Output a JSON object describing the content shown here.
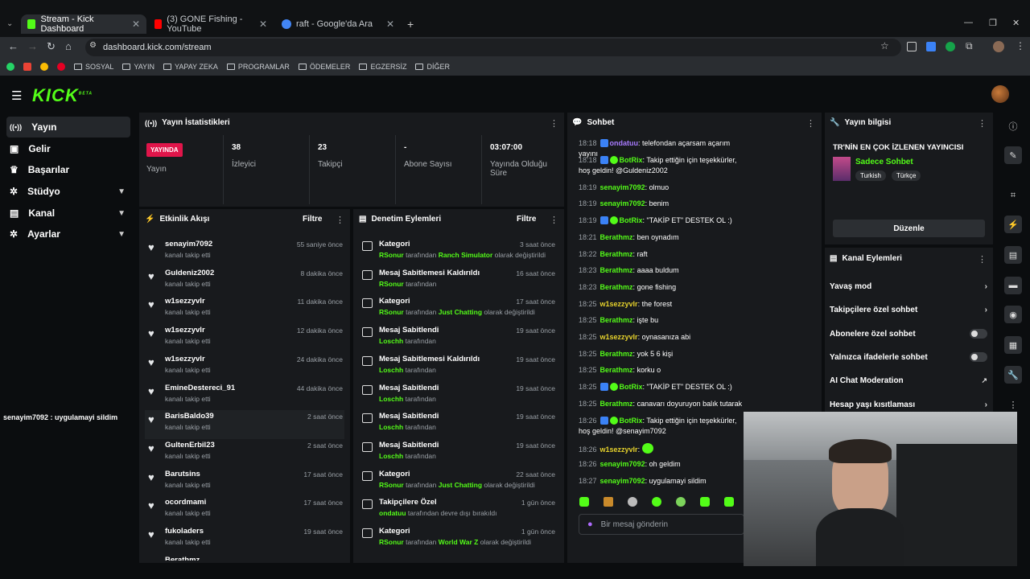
{
  "browser": {
    "tabs": [
      {
        "title": "Stream - Kick Dashboard",
        "icon": "kick-favicon"
      },
      {
        "title": "(3) GONE Fishing - YouTube",
        "icon": "youtube-favicon"
      },
      {
        "title": "raft - Google'da Ara",
        "icon": "google-favicon"
      }
    ],
    "url": "dashboard.kick.com/stream",
    "bookmarks": [
      "SOSYAL",
      "YAYIN",
      "YAPAY ZEKA",
      "PROGRAMLAR",
      "ÖDEMELER",
      "EGZERSİZ",
      "DİĞER"
    ]
  },
  "brand": {
    "logo": "KICK",
    "beta": "BETA",
    "accent": "#53fc18"
  },
  "sidebar": {
    "items": [
      {
        "label": "Yayın",
        "icon": "broadcast-icon"
      },
      {
        "label": "Gelir",
        "icon": "revenue-icon"
      },
      {
        "label": "Başarılar",
        "icon": "trophy-icon"
      },
      {
        "label": "Stüdyo",
        "icon": "gear-icon"
      },
      {
        "label": "Kanal",
        "icon": "channel-icon"
      },
      {
        "label": "Ayarlar",
        "icon": "gear-icon"
      }
    ]
  },
  "overlay_chat": "senayim7092 : uygulamayi sildim",
  "stats": {
    "title": "Yayın İstatistikleri",
    "live_badge": "YAYINDA",
    "live_label": "Yayın",
    "items": [
      {
        "value": "38",
        "label": "İzleyici"
      },
      {
        "value": "23",
        "label": "Takipçi"
      },
      {
        "value": "-",
        "label": "Abone Sayısı"
      },
      {
        "value": "03:07:00",
        "label": "Yayında Olduğu Süre"
      }
    ]
  },
  "activity": {
    "title": "Etkinlik Akışı",
    "filter": "Filtre",
    "items": [
      {
        "name": "senayim7092",
        "sub": "kanalı takip etti",
        "time": "55 saniye önce"
      },
      {
        "name": "Guldeniz2002",
        "sub": "kanalı takip etti",
        "time": "8 dakika önce"
      },
      {
        "name": "w1sezzyvlr",
        "sub": "kanalı takip etti",
        "time": "11 dakika önce"
      },
      {
        "name": "w1sezzyvlr",
        "sub": "kanalı takip etti",
        "time": "12 dakika önce"
      },
      {
        "name": "w1sezzyvlr",
        "sub": "kanalı takip etti",
        "time": "24 dakika önce"
      },
      {
        "name": "EmineDestereci_91",
        "sub": "kanalı takip etti",
        "time": "44 dakika önce"
      },
      {
        "name": "BarisBaldo39",
        "sub": "kanalı takip etti",
        "time": "2 saat önce"
      },
      {
        "name": "GultenErbil23",
        "sub": "kanalı takip etti",
        "time": "2 saat önce"
      },
      {
        "name": "Barutsins",
        "sub": "kanalı takip etti",
        "time": "17 saat önce"
      },
      {
        "name": "ocordmami",
        "sub": "kanalı takip etti",
        "time": "17 saat önce"
      },
      {
        "name": "fukoladers",
        "sub": "kanalı takip etti",
        "time": "19 saat önce"
      },
      {
        "name": "Berathmz",
        "sub": "",
        "time": ""
      }
    ]
  },
  "moderation": {
    "title": "Denetim Eylemleri",
    "filter": "Filtre",
    "items": [
      {
        "name": "Kategori",
        "user": "RSonur",
        "mid": "tarafından",
        "hl": "Ranch Simulator",
        "end": "olarak değiştirildi",
        "time": "3 saat önce"
      },
      {
        "name": "Mesaj Sabitlemesi Kaldırıldı",
        "user": "RSonur",
        "mid": "tarafından",
        "hl": "",
        "end": "",
        "time": "16 saat önce"
      },
      {
        "name": "Kategori",
        "user": "RSonur",
        "mid": "tarafından",
        "hl": "Just Chatting",
        "end": "olarak değiştirildi",
        "time": "17 saat önce"
      },
      {
        "name": "Mesaj Sabitlendi",
        "user": "Loschh",
        "mid": "tarafından",
        "hl": "",
        "end": "",
        "time": "19 saat önce"
      },
      {
        "name": "Mesaj Sabitlemesi Kaldırıldı",
        "user": "Loschh",
        "mid": "tarafından",
        "hl": "",
        "end": "",
        "time": "19 saat önce"
      },
      {
        "name": "Mesaj Sabitlendi",
        "user": "Loschh",
        "mid": "tarafından",
        "hl": "",
        "end": "",
        "time": "19 saat önce"
      },
      {
        "name": "Mesaj Sabitlendi",
        "user": "Loschh",
        "mid": "tarafından",
        "hl": "",
        "end": "",
        "time": "19 saat önce"
      },
      {
        "name": "Mesaj Sabitlendi",
        "user": "Loschh",
        "mid": "tarafından",
        "hl": "",
        "end": "",
        "time": "19 saat önce"
      },
      {
        "name": "Kategori",
        "user": "RSonur",
        "mid": "tarafından",
        "hl": "Just Chatting",
        "end": "olarak değiştirildi",
        "time": "22 saat önce"
      },
      {
        "name": "Takipçilere Özel",
        "user": "ondatuu",
        "mid": "tarafından devre dışı bırakıldı",
        "hl": "",
        "end": "",
        "time": "1 gün önce"
      },
      {
        "name": "Kategori",
        "user": "RSonur",
        "mid": "tarafından",
        "hl": "World War Z",
        "end": "olarak değiştirildi",
        "time": "1 gün önce"
      }
    ]
  },
  "chat": {
    "title": "Sohbet",
    "placeholder": "Bir mesaj gönderin",
    "messages": [
      {
        "time": "18:18",
        "user": "ondatuu",
        "color": "#a97bff",
        "text": "telefondan açarsam açarım yayını",
        "badges": 1
      },
      {
        "time": "18:18",
        "user": "BotRix",
        "color": "#53fc18",
        "text": "Takip ettiğin için teşekkürler, hoş geldin! @Guldeniz2002",
        "badges": 2
      },
      {
        "time": "18:19",
        "user": "senayim7092",
        "color": "#53fc18",
        "text": "olmuo",
        "badges": 0
      },
      {
        "time": "18:19",
        "user": "senayim7092",
        "color": "#53fc18",
        "text": "benim",
        "badges": 0
      },
      {
        "time": "18:19",
        "user": "BotRix",
        "color": "#53fc18",
        "text": "\"TAKİP ET\" DESTEK OL :)",
        "badges": 2
      },
      {
        "time": "18:21",
        "user": "Berathmz",
        "color": "#53fc18",
        "text": "ben oynadım",
        "badges": 0
      },
      {
        "time": "18:22",
        "user": "Berathmz",
        "color": "#53fc18",
        "text": "raft",
        "badges": 0
      },
      {
        "time": "18:23",
        "user": "Berathmz",
        "color": "#53fc18",
        "text": "aaaa buldum",
        "badges": 0
      },
      {
        "time": "18:23",
        "user": "Berathmz",
        "color": "#53fc18",
        "text": "gone fishing",
        "badges": 0
      },
      {
        "time": "18:25",
        "user": "w1sezzyvlr",
        "color": "#e5d12c",
        "text": "the forest",
        "badges": 0
      },
      {
        "time": "18:25",
        "user": "Berathmz",
        "color": "#53fc18",
        "text": "işte bu",
        "badges": 0
      },
      {
        "time": "18:25",
        "user": "w1sezzyvlr",
        "color": "#e5d12c",
        "text": "oynasanıza abi",
        "badges": 0
      },
      {
        "time": "18:25",
        "user": "Berathmz",
        "color": "#53fc18",
        "text": "yok 5 6 kişi",
        "badges": 0
      },
      {
        "time": "18:25",
        "user": "Berathmz",
        "color": "#53fc18",
        "text": "korku o",
        "badges": 0
      },
      {
        "time": "18:25",
        "user": "BotRix",
        "color": "#53fc18",
        "text": "\"TAKİP ET\" DESTEK OL :)",
        "badges": 2
      },
      {
        "time": "18:25",
        "user": "Berathmz",
        "color": "#53fc18",
        "text": "canavarı doyuruyon balık tutarak",
        "badges": 0
      },
      {
        "time": "18:26",
        "user": "BotRix",
        "color": "#53fc18",
        "text": "Takip ettiğin için teşekkürler, hoş geldin! @senayim7092",
        "badges": 2
      },
      {
        "time": "18:26",
        "user": "w1sezzyvlr",
        "color": "#e5d12c",
        "text": "",
        "badges": 0
      },
      {
        "time": "18:26",
        "user": "senayim7092",
        "color": "#53fc18",
        "text": "oh geldim",
        "badges": 0
      },
      {
        "time": "18:27",
        "user": "senayim7092",
        "color": "#53fc18",
        "text": "uygulamayi sildim",
        "badges": 0
      }
    ]
  },
  "stream_info": {
    "title": "Yayın bilgisi",
    "stream_title": "TR'NİN EN ÇOK İZLENEN YAYINCISI",
    "mode": "Sadece Sohbet",
    "tags": [
      "Turkish",
      "Türkçe"
    ],
    "edit": "Düzenle"
  },
  "channel_actions": {
    "title": "Kanal Eylemleri",
    "items": [
      {
        "label": "Yavaş mod",
        "kind": "arrow"
      },
      {
        "label": "Takipçilere özel sohbet",
        "kind": "arrow"
      },
      {
        "label": "Abonelere özel sohbet",
        "kind": "toggle"
      },
      {
        "label": "Yalnızca ifadelerle sohbet",
        "kind": "toggle"
      },
      {
        "label": "AI Chat Moderation",
        "kind": "external"
      },
      {
        "label": "Hesap yaşı kısıtlaması",
        "kind": "arrow"
      }
    ]
  }
}
